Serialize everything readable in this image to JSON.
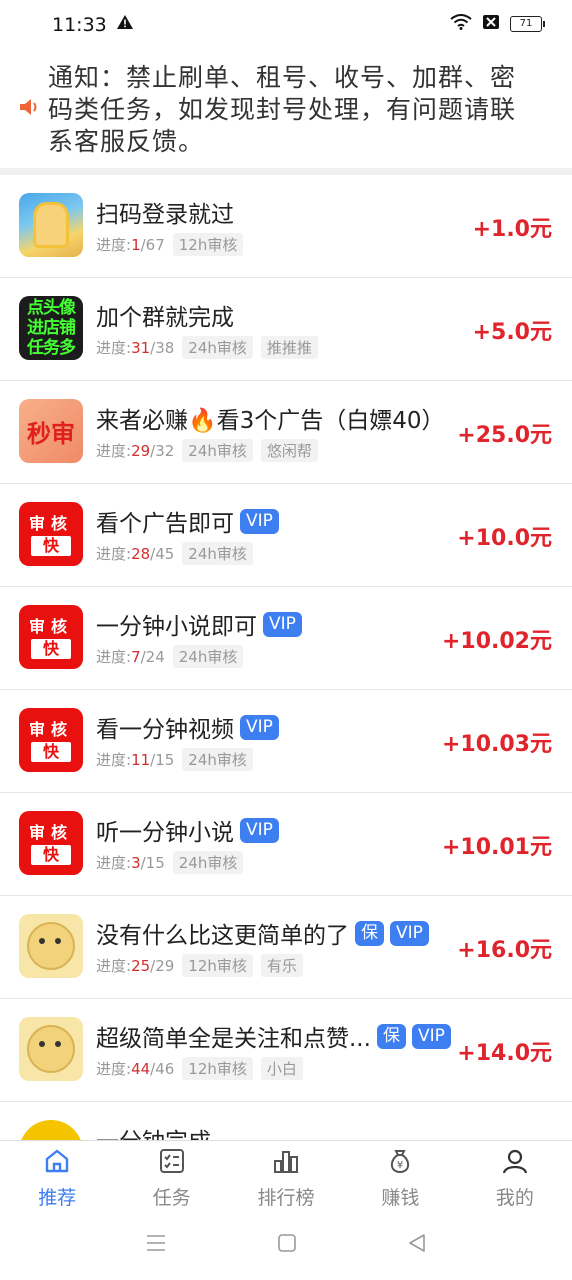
{
  "status_bar": {
    "time": "11:33",
    "battery": "71"
  },
  "notice": {
    "text": "通知：禁止刷单、租号、收号、加群、密码类任务，如发现封号处理，有问题请联系客服反馈。"
  },
  "tasks": [
    {
      "title": "扫码登录就过",
      "progress_label": "进度:",
      "done": "1",
      "total": "/67",
      "review": "12h审核",
      "reward": "+1.0元"
    },
    {
      "title": "加个群就完成",
      "progress_label": "进度:",
      "done": "31",
      "total": "/38",
      "review": "24h审核",
      "tag": "推推推",
      "reward": "+5.0元",
      "thumb_lines": [
        "点头像",
        "进店铺",
        "任务多"
      ]
    },
    {
      "title": "来者必赚🔥看3个广告（白嫖40）",
      "progress_label": "进度:",
      "done": "29",
      "total": "/32",
      "review": "24h审核",
      "tag": "悠闲帮",
      "reward": "+25.0元",
      "thumb_text": "秒审"
    },
    {
      "title": "看个广告即可",
      "vip": "VIP",
      "progress_label": "进度:",
      "done": "28",
      "total": "/45",
      "review": "24h审核",
      "reward": "+10.0元",
      "thumb_top": "审核",
      "thumb_bottom": "快"
    },
    {
      "title": "一分钟小说即可",
      "vip": "VIP",
      "progress_label": "进度:",
      "done": "7",
      "total": "/24",
      "review": "24h审核",
      "reward": "+10.02元",
      "thumb_top": "审核",
      "thumb_bottom": "快"
    },
    {
      "title": "看一分钟视频",
      "vip": "VIP",
      "progress_label": "进度:",
      "done": "11",
      "total": "/15",
      "review": "24h审核",
      "reward": "+10.03元",
      "thumb_top": "审核",
      "thumb_bottom": "快"
    },
    {
      "title": "听一分钟小说",
      "vip": "VIP",
      "progress_label": "进度:",
      "done": "3",
      "total": "/15",
      "review": "24h审核",
      "reward": "+10.01元",
      "thumb_top": "审核",
      "thumb_bottom": "快"
    },
    {
      "title": "没有什么比这更简单的了",
      "bao": "保",
      "vip": "VIP",
      "progress_label": "进度:",
      "done": "25",
      "total": "/29",
      "review": "12h审核",
      "tag": "有乐",
      "reward": "+16.0元"
    },
    {
      "title": "超级简单全是关注和点赞...",
      "bao": "保",
      "vip": "VIP",
      "progress_label": "进度:",
      "done": "44",
      "total": "/46",
      "review": "12h审核",
      "tag": "小白",
      "reward": "+14.0元"
    },
    {
      "title": "一分钟完成"
    }
  ],
  "bottom_nav": [
    {
      "label": "推荐",
      "icon": "home-icon",
      "active": true
    },
    {
      "label": "任务",
      "icon": "task-list-icon"
    },
    {
      "label": "排行榜",
      "icon": "bar-chart-icon"
    },
    {
      "label": "赚钱",
      "icon": "money-bag-icon"
    },
    {
      "label": "我的",
      "icon": "user-icon"
    }
  ],
  "colors": {
    "accent": "#3d7ef0",
    "reward": "#e0242b",
    "progress_done": "#d32f2f"
  }
}
